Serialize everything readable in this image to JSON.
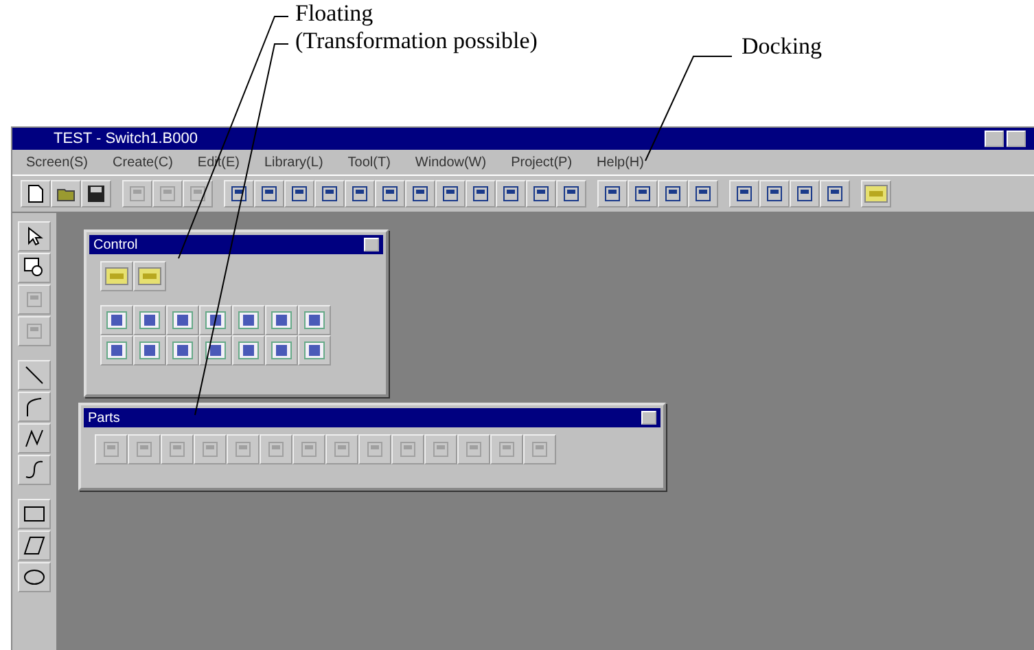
{
  "callouts": [
    {
      "lines": [
        "Floating",
        "(Transformation possible)"
      ]
    },
    {
      "lines": [
        "Docking"
      ]
    }
  ],
  "window": {
    "title": "TEST - Switch1.B000"
  },
  "menu": [
    "Screen(S)",
    "Create(C)",
    "Edit(E)",
    "Library(L)",
    "Tool(T)",
    "Window(W)",
    "Project(P)",
    "Help(H)"
  ],
  "palettes": [
    {
      "title": "Control"
    },
    {
      "title": "Parts"
    }
  ]
}
